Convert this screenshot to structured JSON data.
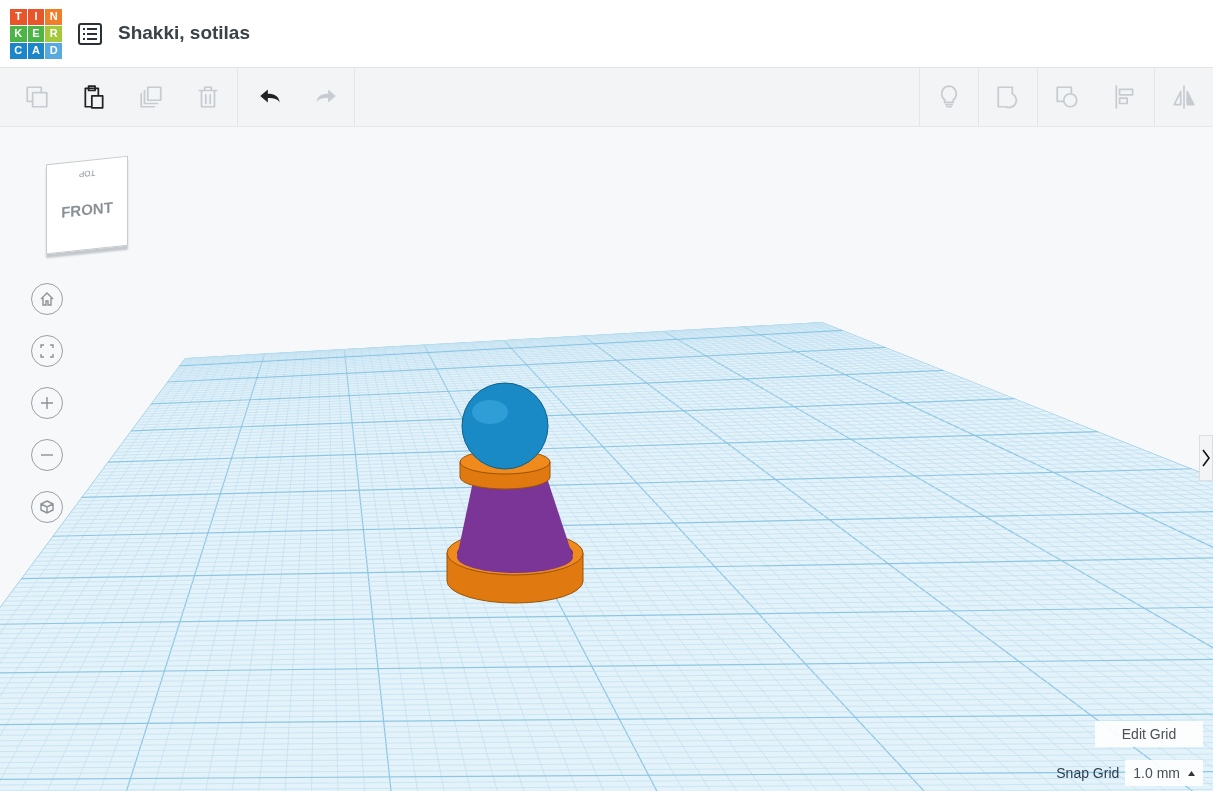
{
  "logo": [
    {
      "letter": "T",
      "color": "#e8552b"
    },
    {
      "letter": "I",
      "color": "#e8552b"
    },
    {
      "letter": "N",
      "color": "#f07d2a"
    },
    {
      "letter": "K",
      "color": "#4fb448"
    },
    {
      "letter": "E",
      "color": "#4fb448"
    },
    {
      "letter": "R",
      "color": "#a3c83a"
    },
    {
      "letter": "C",
      "color": "#1c86c8"
    },
    {
      "letter": "A",
      "color": "#1c86c8"
    },
    {
      "letter": "D",
      "color": "#58a9de"
    }
  ],
  "title": "Shakki, sotilas",
  "toolbar_left": [
    {
      "kind": "copy",
      "disabled": true
    },
    {
      "kind": "paste",
      "disabled": false
    },
    {
      "kind": "duplicate",
      "disabled": true
    },
    {
      "kind": "delete",
      "disabled": true
    },
    {
      "kind": "undo",
      "disabled": false
    },
    {
      "kind": "redo",
      "disabled": true
    }
  ],
  "toolbar_right": [
    {
      "kind": "bulb",
      "disabled": true
    },
    {
      "kind": "group",
      "disabled": true
    },
    {
      "kind": "ungroup",
      "disabled": true
    },
    {
      "kind": "align",
      "disabled": true
    },
    {
      "kind": "mirror",
      "disabled": true
    }
  ],
  "view_cube": {
    "front": "FRONT",
    "top": "TOP"
  },
  "grid_controls": {
    "edit": "Edit Grid",
    "snap_label": "Snap Grid",
    "snap_value": "1.0 mm"
  }
}
